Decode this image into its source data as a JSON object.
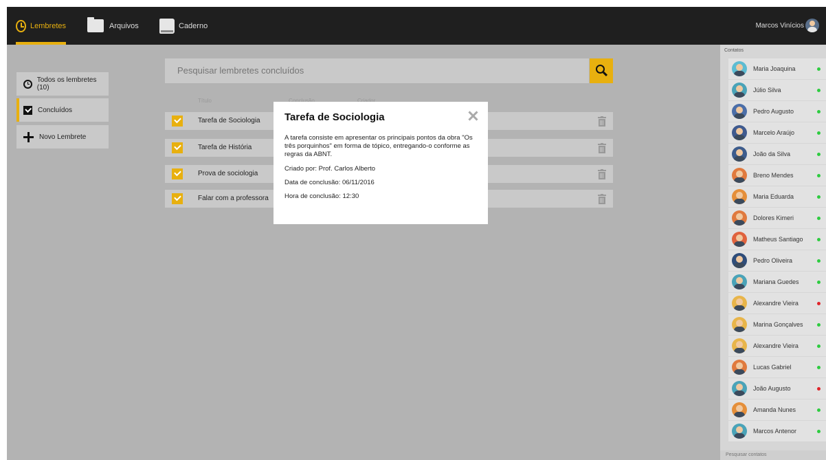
{
  "nav": {
    "tabs": [
      {
        "label": "Lembretes",
        "icon": "clock-icon",
        "active": true
      },
      {
        "label": "Arquivos",
        "icon": "folder-icon",
        "active": false
      },
      {
        "label": "Caderno",
        "icon": "notebook-icon",
        "active": false
      }
    ],
    "user_name": "Marcos Vinícios"
  },
  "colors": {
    "accent": "#e8b00f",
    "topbar": "#1f1f1f",
    "main_bg": "#b3b3b3",
    "panel_bg": "#c9c9c9",
    "online": "#2ecc40",
    "offline": "#e0242a"
  },
  "sidebar": {
    "items": [
      {
        "label": "Todos os lembretes (10)",
        "icon": "clock-icon"
      },
      {
        "label": "Concluídos",
        "icon": "checkbox-icon",
        "active": true
      },
      {
        "label": "Novo Lembrete",
        "icon": "plus-icon"
      }
    ]
  },
  "search": {
    "placeholder": "Pesquisar lembretes concluídos",
    "icon": "search-icon"
  },
  "table": {
    "columns": [
      "Título",
      "Conclusão",
      "Criador"
    ],
    "rows": [
      {
        "title": "Tarefa de Sociologia",
        "checked": true
      },
      {
        "title": "Tarefa de História",
        "checked": true
      },
      {
        "title": "Prova de sociologia",
        "checked": true
      },
      {
        "title": "Falar com a professora",
        "checked": true
      }
    ]
  },
  "modal": {
    "title": "Tarefa de Sociologia",
    "description": "A tarefa consiste em apresentar os principais pontos da obra \"Os três porquinhos\" em forma de tópico, entregando-o conforme as regras da ABNT.",
    "created_by": "Criado por: Prof. Carlos Alberto",
    "date": "Data de conclusão: 06/11/2016",
    "time": "Hora de conclusão: 12:30"
  },
  "contacts": {
    "header": "Contatos",
    "search_placeholder": "Pesquisar contatos",
    "items": [
      {
        "name": "Maria Joaquina",
        "status": "online",
        "avatar_bg": "#5dbcd2"
      },
      {
        "name": "Júlio Silva",
        "status": "online",
        "avatar_bg": "#4aa3b8"
      },
      {
        "name": "Pedro Augusto",
        "status": "online",
        "avatar_bg": "#4b6ea8"
      },
      {
        "name": "Marcelo Araújo",
        "status": "online",
        "avatar_bg": "#3f5a8e"
      },
      {
        "name": "João da Silva",
        "status": "online",
        "avatar_bg": "#3d5c8c"
      },
      {
        "name": "Breno Mendes",
        "status": "online",
        "avatar_bg": "#e07a3e"
      },
      {
        "name": "Maria Eduarda",
        "status": "online",
        "avatar_bg": "#e58f3a"
      },
      {
        "name": "Dolores Kimeri",
        "status": "online",
        "avatar_bg": "#e07a3e"
      },
      {
        "name": "Matheus Santiago",
        "status": "online",
        "avatar_bg": "#e0633e"
      },
      {
        "name": "Pedro Oliveira",
        "status": "online",
        "avatar_bg": "#2f4d7a"
      },
      {
        "name": "Mariana Guedes",
        "status": "online",
        "avatar_bg": "#4aa3b8"
      },
      {
        "name": "Alexandre Vieira",
        "status": "offline",
        "avatar_bg": "#e8b54a"
      },
      {
        "name": "Marina Gonçalves",
        "status": "online",
        "avatar_bg": "#e8b54a"
      },
      {
        "name": "Alexandre Vieira",
        "status": "online",
        "avatar_bg": "#e8b54a"
      },
      {
        "name": "Lucas Gabriel",
        "status": "online",
        "avatar_bg": "#e07a3e"
      },
      {
        "name": "João Augusto",
        "status": "offline",
        "avatar_bg": "#4aa3b8"
      },
      {
        "name": "Amanda Nunes",
        "status": "online",
        "avatar_bg": "#e58f3a"
      },
      {
        "name": "Marcos Antenor",
        "status": "online",
        "avatar_bg": "#4aa3b8"
      }
    ]
  }
}
